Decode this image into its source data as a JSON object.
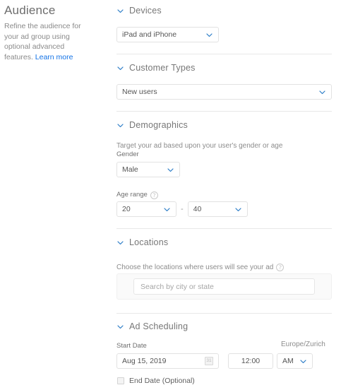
{
  "intro": {
    "title": "Audience",
    "description": "Refine the audience for your ad group using optional advanced features.",
    "link_label": "Learn more"
  },
  "colors": {
    "accent": "#1473e6",
    "chevron": "#2a7cc7",
    "heading": "#6d6d6d",
    "divider": "#e8e8e8",
    "border": "#e2e2e2"
  },
  "sections": {
    "devices": {
      "title": "Devices",
      "chevron_icon": "chevron-down-icon",
      "select": {
        "value": "iPad and iPhone",
        "caret_icon": "chevron-down-icon"
      }
    },
    "customer_types": {
      "title": "Customer Types",
      "chevron_icon": "chevron-down-icon",
      "select": {
        "value": "New users",
        "caret_icon": "chevron-down-icon"
      }
    },
    "demographics": {
      "title": "Demographics",
      "chevron_icon": "chevron-down-icon",
      "helper": "Target your ad based upon your user's gender or age",
      "gender_label": "Gender",
      "gender_select": {
        "value": "Male",
        "caret_icon": "chevron-down-icon"
      },
      "age_label": "Age range",
      "age_help_icon": "help-circle-icon",
      "age_help_glyph": "?",
      "age_from": {
        "value": "20",
        "caret_icon": "chevron-down-icon"
      },
      "age_separator": "-",
      "age_to": {
        "value": "40",
        "caret_icon": "chevron-down-icon"
      }
    },
    "locations": {
      "title": "Locations",
      "chevron_icon": "chevron-down-icon",
      "helper": "Choose the locations where users will see your ad",
      "help_icon": "help-circle-icon",
      "help_glyph": "?",
      "search_placeholder": "Search by city or state"
    },
    "ad_scheduling": {
      "title": "Ad Scheduling",
      "chevron_icon": "chevron-down-icon",
      "start_date_label": "Start Date",
      "timezone": "Europe/Zurich",
      "date_value": "Aug 15, 2019",
      "calendar_icon": "calendar-icon",
      "calendar_glyph": "31",
      "time_value": "12:00",
      "meridiem": {
        "value": "AM",
        "caret_icon": "chevron-down-icon"
      },
      "end_date_label": "End Date (Optional)",
      "end_date_checked": false
    }
  }
}
